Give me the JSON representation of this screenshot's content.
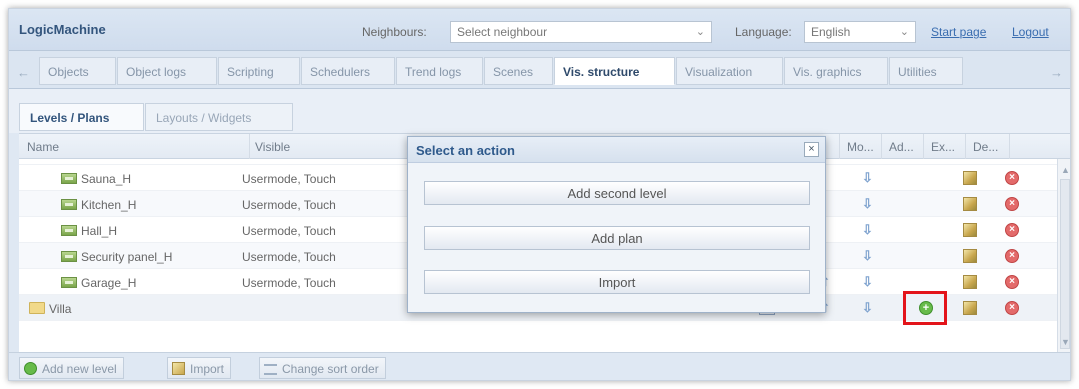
{
  "header": {
    "app_title": "LogicMachine",
    "neighbours_label": "Neighbours:",
    "neighbours_value": "Select neighbour",
    "language_label": "Language:",
    "language_value": "English",
    "start_page": "Start page",
    "logout": "Logout"
  },
  "tabs": [
    "Objects",
    "Object logs",
    "Scripting",
    "Schedulers",
    "Trend logs",
    "Scenes",
    "Vis. structure",
    "Visualization",
    "Vis. graphics",
    "Utilities"
  ],
  "subtabs": [
    "Levels / Plans",
    "Layouts / Widgets"
  ],
  "columns": {
    "name": "Name",
    "visible": "Visible",
    "mo": "Mo...",
    "ad": "Ad...",
    "ex": "Ex...",
    "de": "De..."
  },
  "rows": [
    {
      "name": "Sauna_H",
      "visible": "Usermode, Touch"
    },
    {
      "name": "Kitchen_H",
      "visible": "Usermode, Touch"
    },
    {
      "name": "Hall_H",
      "visible": "Usermode, Touch"
    },
    {
      "name": "Security panel_H",
      "visible": "Usermode, Touch"
    },
    {
      "name": "Garage_H",
      "visible": "Usermode, Touch"
    },
    {
      "name": "Villa",
      "visible": ""
    }
  ],
  "footer": {
    "add_level": "Add new level",
    "import": "Import",
    "sort": "Change sort order"
  },
  "dialog": {
    "title": "Select an action",
    "close": "×",
    "buttons": [
      "Add second level",
      "Add plan",
      "Import"
    ]
  },
  "colors": {
    "highlight": "#e3141a",
    "accent": "#2f5a8c"
  }
}
